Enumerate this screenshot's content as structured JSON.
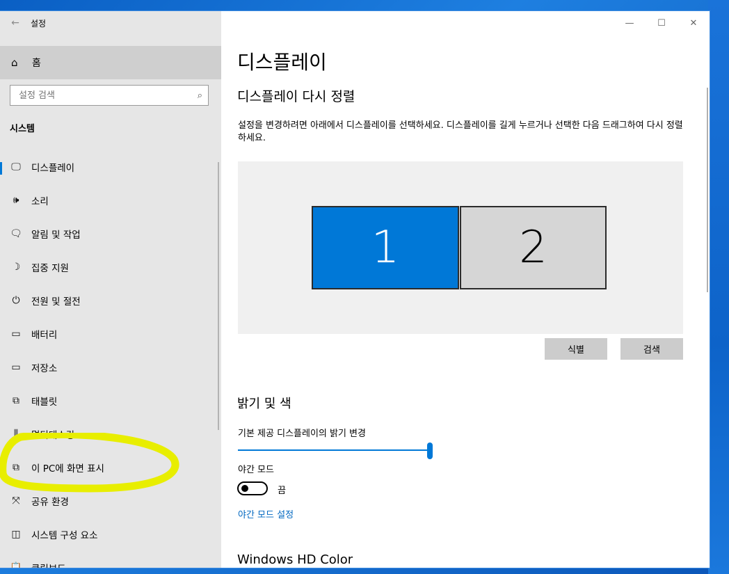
{
  "window": {
    "title": "설정",
    "minimize_glyph": "—",
    "maximize_glyph": "☐",
    "close_glyph": "✕"
  },
  "sidebar": {
    "home_label": "홈",
    "search_placeholder": "설정 검색",
    "section_title": "시스템",
    "items": [
      {
        "label": "디스플레이",
        "icon": "monitor-icon",
        "glyph": "🖵"
      },
      {
        "label": "소리",
        "icon": "speaker-icon",
        "glyph": "🕪"
      },
      {
        "label": "알림 및 작업",
        "icon": "notification-icon",
        "glyph": "🗨"
      },
      {
        "label": "집중 지원",
        "icon": "moon-icon",
        "glyph": "☽"
      },
      {
        "label": "전원 및 절전",
        "icon": "power-icon",
        "glyph": "⏻"
      },
      {
        "label": "배터리",
        "icon": "battery-icon",
        "glyph": "▭"
      },
      {
        "label": "저장소",
        "icon": "storage-icon",
        "glyph": "▭"
      },
      {
        "label": "태블릿",
        "icon": "tablet-icon",
        "glyph": "⧉"
      },
      {
        "label": "멀티태스킹",
        "icon": "multitasking-icon",
        "glyph": "⫼"
      },
      {
        "label": "이 PC에 화면 표시",
        "icon": "project-icon",
        "glyph": "⧉"
      },
      {
        "label": "공유 환경",
        "icon": "share-icon",
        "glyph": "⤧"
      },
      {
        "label": "시스템 구성 요소",
        "icon": "components-icon",
        "glyph": "◫"
      },
      {
        "label": "클립보드",
        "icon": "clipboard-icon",
        "glyph": "📋"
      }
    ]
  },
  "main": {
    "title": "디스플레이",
    "arrange_title": "디스플레이 다시 정렬",
    "arrange_desc": "설정을 변경하려면 아래에서 디스플레이를 선택하세요. 디스플레이를 길게 누르거나 선택한 다음 드래그하여 다시 정렬하세요.",
    "monitor1": "1",
    "monitor2": "2",
    "identify_button": "식별",
    "detect_button": "검색",
    "brightness_title": "밝기 및 색",
    "brightness_label": "기본 제공 디스플레이의 밝기 변경",
    "brightness_value": 1.0,
    "night_mode_label": "야간 모드",
    "night_mode_state": "끔",
    "night_mode_link": "야간 모드 설정",
    "hd_color_title": "Windows HD Color"
  },
  "colors": {
    "accent": "#0078d7",
    "highlight": "#e8ee00"
  }
}
